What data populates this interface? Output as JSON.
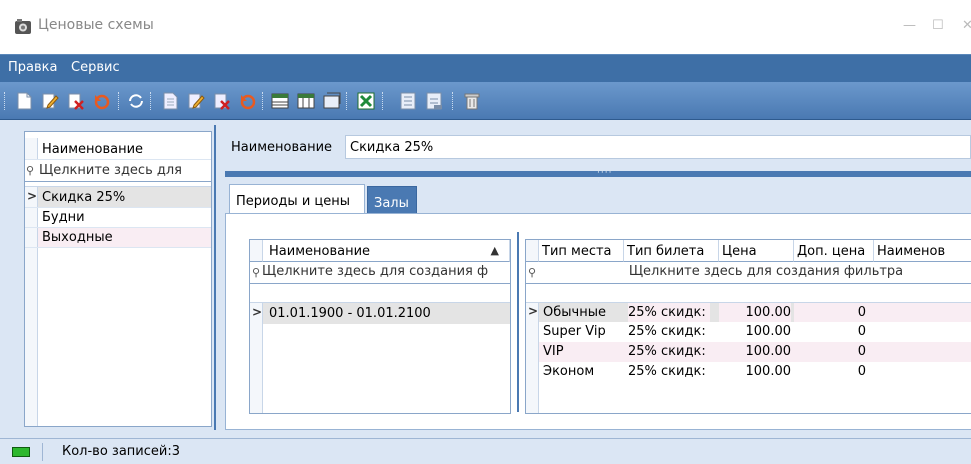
{
  "window": {
    "title": "Ценовые схемы",
    "minimize_glyph": "—",
    "maximize_glyph": "☐",
    "close_glyph": "✕"
  },
  "menu": {
    "items": [
      "Правка",
      "Сервис"
    ]
  },
  "toolbar": {
    "groups": [
      [
        "new-icon",
        "edit-icon",
        "delete-icon",
        "undo-icon",
        "refresh-icon"
      ],
      [
        "new-doc-icon",
        "edit-doc-icon",
        "delete-doc-icon",
        "undo-doc-icon",
        "grid-icon",
        "columns-icon",
        "open-icon"
      ],
      [
        "excel-icon"
      ],
      [
        "layout-icon",
        "layout-remove-icon"
      ],
      [
        "trash-icon"
      ]
    ]
  },
  "left_grid": {
    "header": "Наименование",
    "filter_text": "Щелкните здесь для",
    "rows": [
      "Скидка 25%",
      "Будни",
      "Выходные"
    ],
    "selected_index": 0
  },
  "detail": {
    "name_label": "Наименование",
    "name_value": "Скидка 25%"
  },
  "tabs": [
    {
      "label": "Периоды и цены",
      "active": true
    },
    {
      "label": "Залы",
      "active": false
    }
  ],
  "periods_grid": {
    "header": "Наименование",
    "sort_glyph": "▲",
    "filter_text": "Щелкните здесь для создания ф",
    "rows": [
      "01.01.1900 - 01.01.2100"
    ],
    "selected_index": 0
  },
  "prices_grid": {
    "columns": [
      "Тип места",
      "Тип билета",
      "Цена",
      "Доп. цена",
      "Наименов"
    ],
    "filter_text": "Щелкните здесь для создания фильтра",
    "rows": [
      [
        "Обычные",
        "25% скидк:",
        "100.00",
        "0",
        ""
      ],
      [
        "Super Vip",
        "25% скидк:",
        "100.00",
        "0",
        ""
      ],
      [
        "VIP",
        "25% скидк:",
        "100.00",
        "0",
        ""
      ],
      [
        "Эконом",
        "25% скидк:",
        "100.00",
        "0",
        ""
      ]
    ],
    "selected_index": 0
  },
  "status": {
    "records_text": "Кол-во записей:3"
  },
  "colors": {
    "menu_bg": "#3e6fa6",
    "toolbar_bg": "#5a88c0",
    "panel_bg": "#dbe6f4",
    "selected_row": "#e4e4e4",
    "alt_row": "#f9edf3"
  }
}
